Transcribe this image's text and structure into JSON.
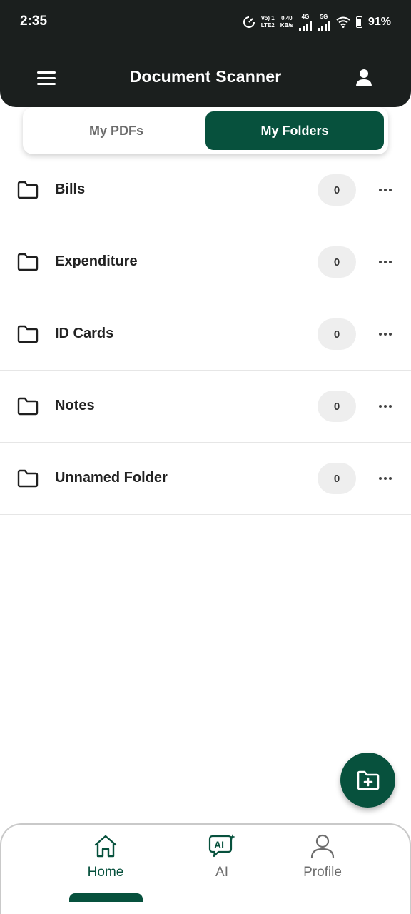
{
  "status_bar": {
    "time": "2:35",
    "network_top": "Vo) 1",
    "network_bottom": "LTE2",
    "speed_value": "0.40",
    "speed_unit": "KB/s",
    "sig1_label": "4G",
    "sig2_label": "5G",
    "battery": "91%"
  },
  "header": {
    "title": "Document Scanner",
    "menu_icon": "hamburger-menu-icon",
    "profile_icon": "user-icon"
  },
  "tabs": [
    {
      "label": "My PDFs",
      "active": false
    },
    {
      "label": "My Folders",
      "active": true
    }
  ],
  "folders": [
    {
      "name": "Bills",
      "count": "0"
    },
    {
      "name": "Expenditure",
      "count": "0"
    },
    {
      "name": "ID Cards",
      "count": "0"
    },
    {
      "name": "Notes",
      "count": "0"
    },
    {
      "name": "Unnamed Folder",
      "count": "0"
    }
  ],
  "fab": {
    "icon": "add-folder-icon"
  },
  "bottom_nav": [
    {
      "label": "Home",
      "icon": "home-icon",
      "active": true
    },
    {
      "label": "AI",
      "icon": "ai-chat-icon",
      "active": false
    },
    {
      "label": "Profile",
      "icon": "profile-icon",
      "active": false
    }
  ],
  "colors": {
    "primary": "#07513d",
    "header_bg": "#1b1f1e",
    "pill_bg": "#eeeeee"
  }
}
